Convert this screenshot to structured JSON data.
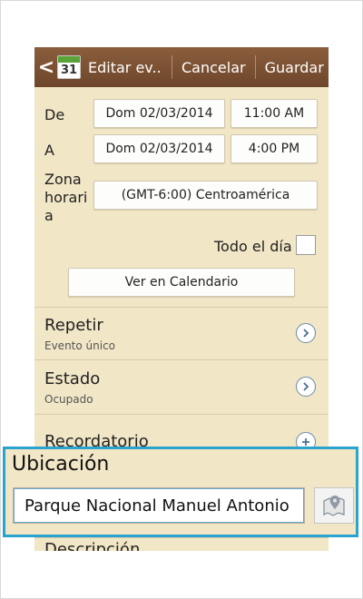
{
  "actionbar": {
    "back_glyph": "<",
    "calendar_day": "31",
    "title": "Editar ev..",
    "cancel_label": "Cancelar",
    "save_label": "Guardar"
  },
  "start": {
    "label": "De",
    "date": "Dom 02/03/2014",
    "time": "11:00 AM"
  },
  "end": {
    "label": "A",
    "date": "Dom 02/03/2014",
    "time": "4:00 PM"
  },
  "timezone": {
    "label_lines": [
      "Zona",
      "horari",
      "a"
    ],
    "value": "(GMT-6:00) Centroamérica"
  },
  "all_day": {
    "label": "Todo el día",
    "checked": false
  },
  "view_calendar_label": "Ver en Calendario",
  "repeat": {
    "title": "Repetir",
    "value": "Evento único"
  },
  "status": {
    "title": "Estado",
    "value": "Ocupado"
  },
  "reminder": {
    "title": "Recordatorio"
  },
  "description": {
    "title": "Descripción"
  },
  "location": {
    "title": "Ubicación",
    "value": "Parque Nacional Manuel Antonio"
  },
  "colors": {
    "actionbar": "#7b5234",
    "background": "#f1e6c6",
    "highlight_border": "#2ba3cf"
  }
}
